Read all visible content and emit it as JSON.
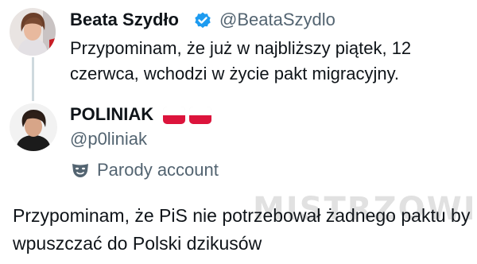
{
  "quoted_tweet": {
    "author_name": "Beata Szydło",
    "author_handle": "@BeataSzydlo",
    "verified_icon": "verified-badge-icon",
    "text": "Przypominam, że już w najbliższy piątek, 12 czerwca, wchodzi w życie pakt migracyjny."
  },
  "reply_tweet": {
    "author_name": "POLINIAK",
    "author_flags": [
      "poland-flag-icon",
      "poland-flag-icon"
    ],
    "author_handle": "@p0liniak",
    "parody_label": "Parody account",
    "parody_icon": "theater-mask-icon",
    "text": "Przypominam, że PiS nie potrzebował żadnego paktu by wpuszczać do Polski dzikusów"
  },
  "watermark": "MISTRZOWIE",
  "colors": {
    "text_primary": "#0f1419",
    "text_secondary": "#536471",
    "verified_blue": "#1d9bf0",
    "thread_line": "#cfd9de",
    "flag_red": "#dc143c"
  }
}
